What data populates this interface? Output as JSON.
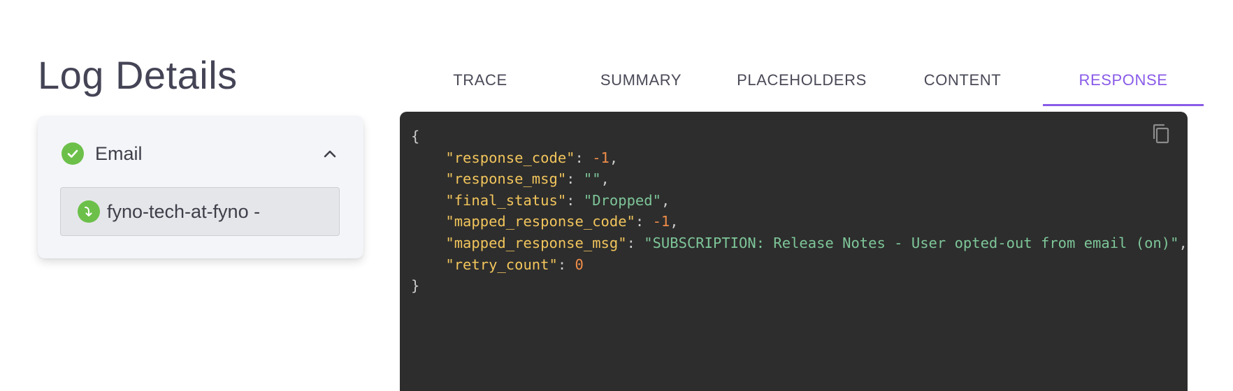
{
  "page": {
    "title": "Log Details"
  },
  "channel": {
    "label": "Email",
    "status_icon": "check-circle-icon",
    "collapse_icon": "chevron-up-icon",
    "provider": {
      "label": "fyno-tech-at-fyno -",
      "icon": "redirect-arrow-icon"
    }
  },
  "tabs": [
    {
      "label": "TRACE",
      "active": false
    },
    {
      "label": "SUMMARY",
      "active": false
    },
    {
      "label": "PLACEHOLDERS",
      "active": false
    },
    {
      "label": "CONTENT",
      "active": false
    },
    {
      "label": "RESPONSE",
      "active": true
    }
  ],
  "response": {
    "open_brace": "{",
    "close_brace": "}",
    "fields": [
      {
        "key": "\"response_code\"",
        "value": "-1",
        "type": "number",
        "comma": ","
      },
      {
        "key": "\"response_msg\"",
        "value": "\"\"",
        "type": "string",
        "comma": ","
      },
      {
        "key": "\"final_status\"",
        "value": "\"Dropped\"",
        "type": "string",
        "comma": ","
      },
      {
        "key": "\"mapped_response_code\"",
        "value": "-1",
        "type": "number",
        "comma": ","
      },
      {
        "key": "\"mapped_response_msg\"",
        "value": "\"SUBSCRIPTION: Release Notes - User opted-out from email (on)\"",
        "type": "string",
        "comma": ","
      },
      {
        "key": "\"retry_count\"",
        "value": "0",
        "type": "number",
        "comma": ""
      }
    ],
    "copy_icon": "copy-icon"
  },
  "colors": {
    "accent": "#8a5be8",
    "success": "#6cc04a",
    "code_bg": "#2d2d2d",
    "json_key": "#f2c55c",
    "json_number": "#f08d49",
    "json_string": "#7ec699"
  }
}
